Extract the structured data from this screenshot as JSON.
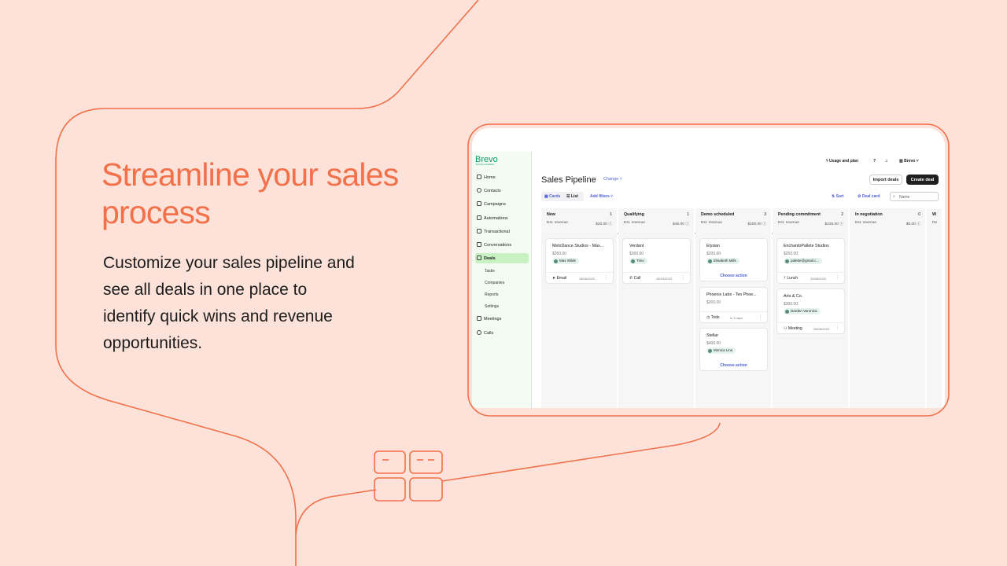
{
  "headline": "Streamline your sales process",
  "body": "Customize your sales pipeline and see all deals in one place to identify quick wins and revenue opportunities.",
  "colors": {
    "accent": "#f2704a",
    "background": "#fde2d9"
  },
  "app": {
    "logo": "Brevo",
    "logo_sub": "Formerly Sendinblue",
    "topbar": {
      "usage": "Usage and plan",
      "account": "Brevo"
    },
    "sidebar": {
      "items": [
        {
          "label": "Home",
          "icon": "home-icon"
        },
        {
          "label": "Contacts",
          "icon": "contacts-icon"
        },
        {
          "label": "Campaigns",
          "icon": "send-icon"
        },
        {
          "label": "Automations",
          "icon": "automation-icon"
        },
        {
          "label": "Transactional",
          "icon": "transfer-icon"
        },
        {
          "label": "Conversations",
          "icon": "chat-icon"
        },
        {
          "label": "Deals",
          "icon": "deals-icon"
        },
        {
          "label": "Meetings",
          "icon": "calendar-icon"
        },
        {
          "label": "Calls",
          "icon": "phone-icon"
        }
      ],
      "subitems": [
        "Tasks",
        "Companies",
        "Reports",
        "Settings"
      ]
    },
    "title": "Sales Pipeline",
    "change": "Change",
    "import_btn": "Import deals",
    "create_btn": "Create deal",
    "view_cards": "Cards",
    "view_list": "List",
    "add_filters": "Add filters",
    "sort": "Sort",
    "deal_card": "Deal card",
    "search_placeholder": "Name",
    "columns": [
      {
        "title": "New",
        "count": "1",
        "est": "Est. revenue",
        "revenue": "$20.00"
      },
      {
        "title": "Qualifying",
        "count": "1",
        "est": "Est. revenue",
        "revenue": "$45.00"
      },
      {
        "title": "Demo scheduled",
        "count": "3",
        "est": "Est. revenue",
        "revenue": "$200.00"
      },
      {
        "title": "Pending commitment",
        "count": "2",
        "est": "Est. revenue",
        "revenue": "$225.00"
      },
      {
        "title": "In negotiation",
        "count": "0",
        "est": "Est. revenue",
        "revenue": "$0.00"
      },
      {
        "title": "W",
        "count": "",
        "est": "Re",
        "revenue": ""
      }
    ],
    "cards": {
      "c1": {
        "name": "MeloDance Studios - Max...",
        "amount": "$350.00",
        "contact": "Max Wilde",
        "action": "Email",
        "date": "18/08/2023"
      },
      "c2": {
        "name": "Verdant",
        "amount": "$300.00",
        "contact": "Timo",
        "action": "Call",
        "date": "18/10/2023"
      },
      "c3": {
        "name": "Elysian",
        "amount": "$200.00",
        "contact": "Elisabeth Mills",
        "choose": "Choose action"
      },
      "c4": {
        "name": "Phoenix Labs - Teo Phoe...",
        "amount": "$200.00",
        "action": "Todo",
        "date": "in 3 days"
      },
      "c5": {
        "name": "Stellar",
        "amount": "$400.00",
        "contact": "Monica Linn",
        "choose": "Choose action"
      },
      "c6": {
        "name": "EnchantoPallete Studios",
        "amount": "$250.00",
        "contact": "palette@gmail.c...",
        "action": "Lunch",
        "date": "20/08/2023"
      },
      "c7": {
        "name": "Arts & Co.",
        "amount": "$300.00",
        "contact": "Darden Veronica",
        "action": "Meeting",
        "date": "28/08/2023"
      }
    }
  }
}
